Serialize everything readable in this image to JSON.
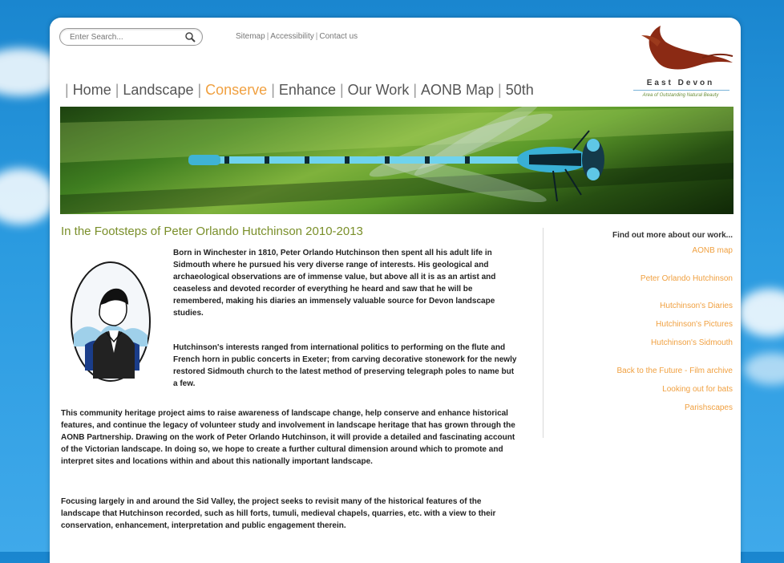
{
  "search": {
    "placeholder": "Enter Search..."
  },
  "toplinks": [
    "Sitemap",
    "Accessibility",
    "Contact us"
  ],
  "logo": {
    "title": "East Devon",
    "subtitle": "Area of Outstanding Natural Beauty"
  },
  "nav": [
    {
      "label": "Home",
      "active": false
    },
    {
      "label": "Landscape",
      "active": false
    },
    {
      "label": "Conserve",
      "active": true
    },
    {
      "label": "Enhance",
      "active": false
    },
    {
      "label": "Our Work",
      "active": false
    },
    {
      "label": "AONB Map",
      "active": false
    },
    {
      "label": "50th",
      "active": false
    }
  ],
  "main": {
    "heading": "In the Footsteps of Peter Orlando Hutchinson 2010-2013",
    "paragraphs": [
      "Born in Winchester in 1810, Peter Orlando Hutchinson then spent all his adult life in Sidmouth where he pursued his very diverse range of interests. His geological and archaeological observations are of immense value, but above all it is as an artist and ceaseless and devoted recorder of everything he heard and saw that he will be remembered, making his diaries an immensely valuable source for Devon landscape studies.",
      "Hutchinson's interests ranged from international politics to performing on the flute and French horn in public concerts in Exeter; from carving decorative stonework for the newly restored Sidmouth church to the latest method of preserving telegraph poles to name but a few.",
      "This community heritage project aims to raise awareness of landscape change, help conserve and enhance historical features, and continue the legacy of volunteer study and involvement in landscape heritage that has grown through the AONB Partnership. Drawing on the work of Peter Orlando Hutchinson, it will provide a detailed and fascinating account of the Victorian landscape. In doing so, we hope to create a further cultural dimension around which to promote and interpret sites and locations within and about this nationally important landscape.",
      "Focusing largely in and around the Sid Valley, the project seeks to revisit many of the historical features of the landscape that Hutchinson recorded, such as hill forts, tumuli, medieval chapels, quarries, etc. with a view to their conservation, enhancement, interpretation and public engagement therein."
    ]
  },
  "sidebar": {
    "heading": "Find out more about our work...",
    "links": [
      "AONB map",
      "Peter Orlando Hutchinson",
      "Hutchinson's Diaries",
      "Hutchinson's Pictures",
      "Hutchinson's Sidmouth",
      "Back to the Future - Film archive",
      "Looking out for bats",
      "Parishscapes"
    ]
  },
  "colors": {
    "accent": "#f0a040",
    "heading": "#7a8f2a",
    "nav": "#555555"
  }
}
